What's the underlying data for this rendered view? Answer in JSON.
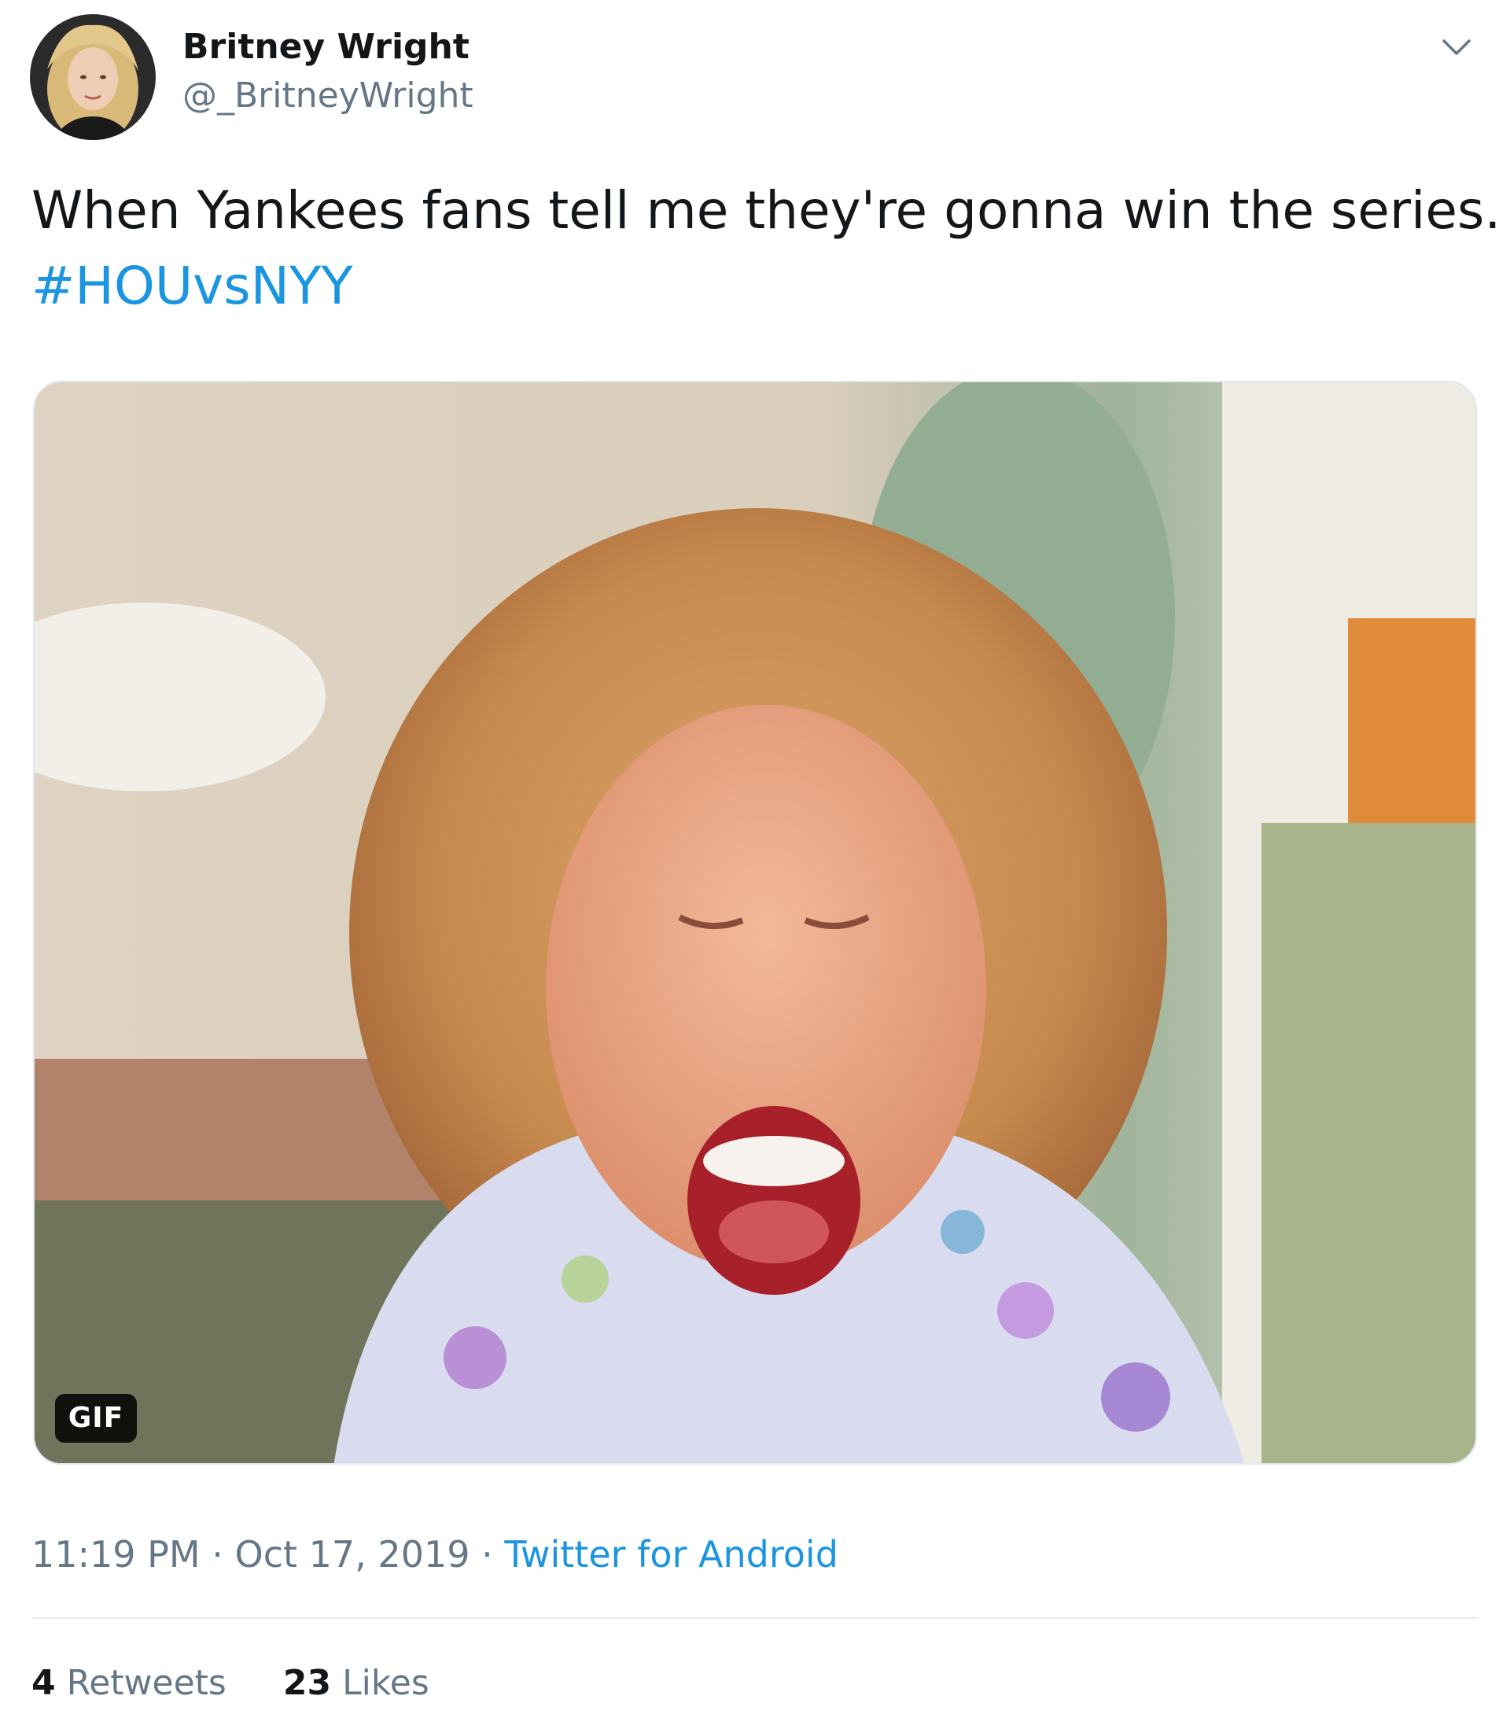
{
  "author": {
    "display_name": "Britney Wright",
    "handle": "@_BritneyWright"
  },
  "tweet": {
    "text": "When Yankees fans tell me they're gonna win the series.",
    "hashtag": "#HOUvsNYY"
  },
  "media": {
    "badge": "GIF"
  },
  "meta": {
    "time": "11:19 PM",
    "separator": "·",
    "date": "Oct 17, 2019",
    "source": "Twitter for Android"
  },
  "stats": {
    "retweets_count": "4",
    "retweets_label": "Retweets",
    "likes_count": "23",
    "likes_label": "Likes"
  },
  "colors": {
    "link": "#1b95e0",
    "secondary_text": "#657786",
    "primary_text": "#14171a",
    "divider": "#e6ecf0"
  },
  "icons": {
    "menu": "chevron-down-icon"
  }
}
